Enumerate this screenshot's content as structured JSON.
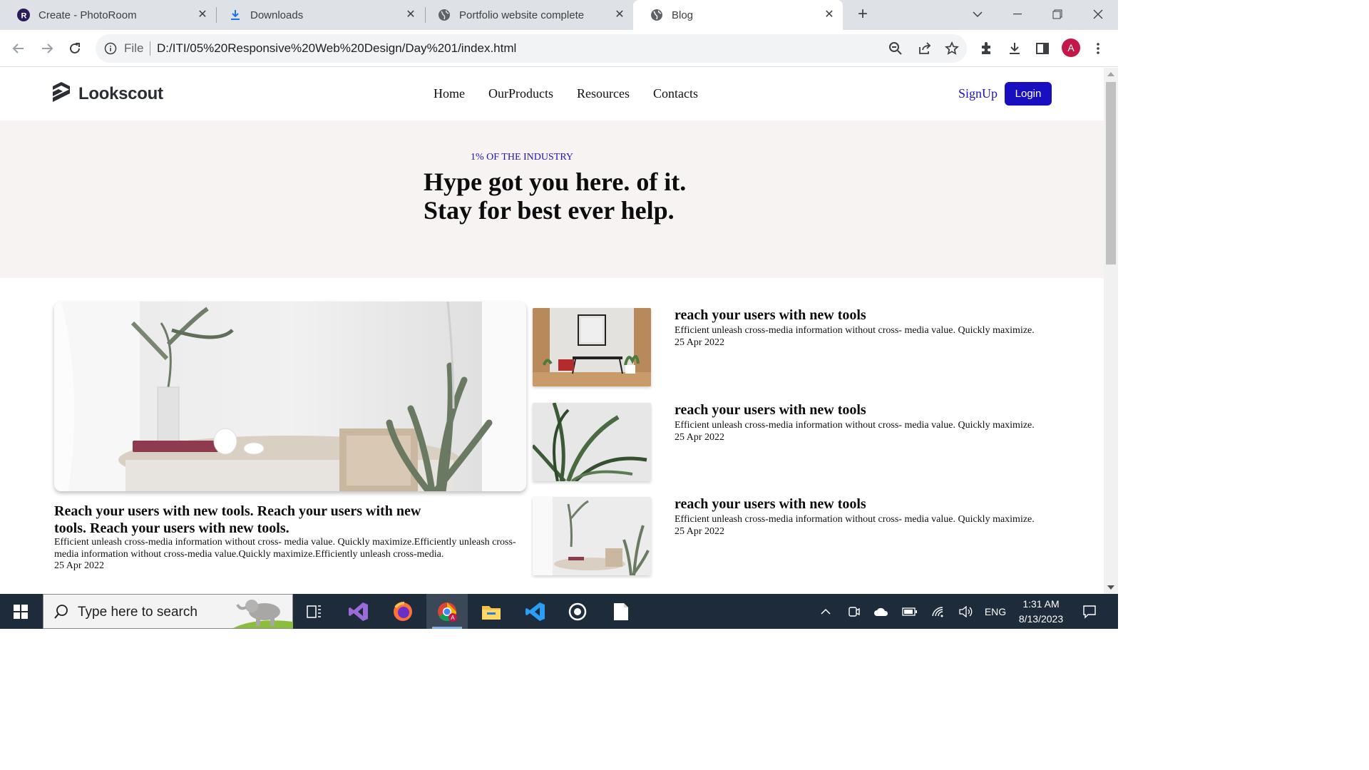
{
  "browser": {
    "tabs": [
      {
        "title": "Create - PhotoRoom",
        "icon": "photoroom-icon"
      },
      {
        "title": "Downloads",
        "icon": "download-icon"
      },
      {
        "title": "Portfolio website complete",
        "icon": "globe-icon"
      },
      {
        "title": "Blog",
        "icon": "globe-icon",
        "active": true
      }
    ],
    "omnibox": {
      "scheme_label": "File",
      "url": "D:/ITI/05%20Responsive%20Web%20Design/Day%201/index.html"
    },
    "profile_initial": "A"
  },
  "site": {
    "logo_text": "Lookscout",
    "nav": [
      "Home",
      "OurProducts",
      "Resources",
      "Contacts"
    ],
    "signup_label": "SignUp",
    "login_label": "Login",
    "hero": {
      "eyebrow": "1% OF THE INDUSTRY",
      "title_line1": "Hype got you here. of it.",
      "title_line2": "Stay for best ever help."
    },
    "featured": {
      "title": "Reach your users with new tools. Reach your users with new tools. Reach your users with new tools.",
      "text": "Efficient unleash cross-media information without cross- media value. Quickly maximize.Efficiently unleash cross-media information without cross-media value.Quickly maximize.Efficiently unleash cross-media.",
      "date": "25 Apr 2022"
    },
    "posts": [
      {
        "title": "reach your users with new tools",
        "text": "Efficient unleash cross-media information without cross- media value. Quickly maximize.",
        "date": "25 Apr 2022"
      },
      {
        "title": "reach your users with new tools",
        "text": "Efficient unleash cross-media information without cross- media value. Quickly maximize.",
        "date": "25 Apr 2022"
      },
      {
        "title": "reach your users with new tools",
        "text": "Efficient unleash cross-media information without cross- media value. Quickly maximize.",
        "date": "25 Apr 2022"
      }
    ]
  },
  "taskbar": {
    "search_placeholder": "Type here to search",
    "apps": [
      "task-view-icon",
      "visual-studio-icon",
      "firefox-icon",
      "chrome-icon",
      "file-explorer-icon",
      "vscode-icon",
      "obs-icon",
      "notepad-icon"
    ],
    "language": "ENG",
    "time": "1:31 AM",
    "date": "8/13/2023"
  },
  "colors": {
    "brand_blue": "#1a0fc0",
    "hero_bg": "#f7f3f3",
    "taskbar_bg": "#1e2b3b"
  }
}
